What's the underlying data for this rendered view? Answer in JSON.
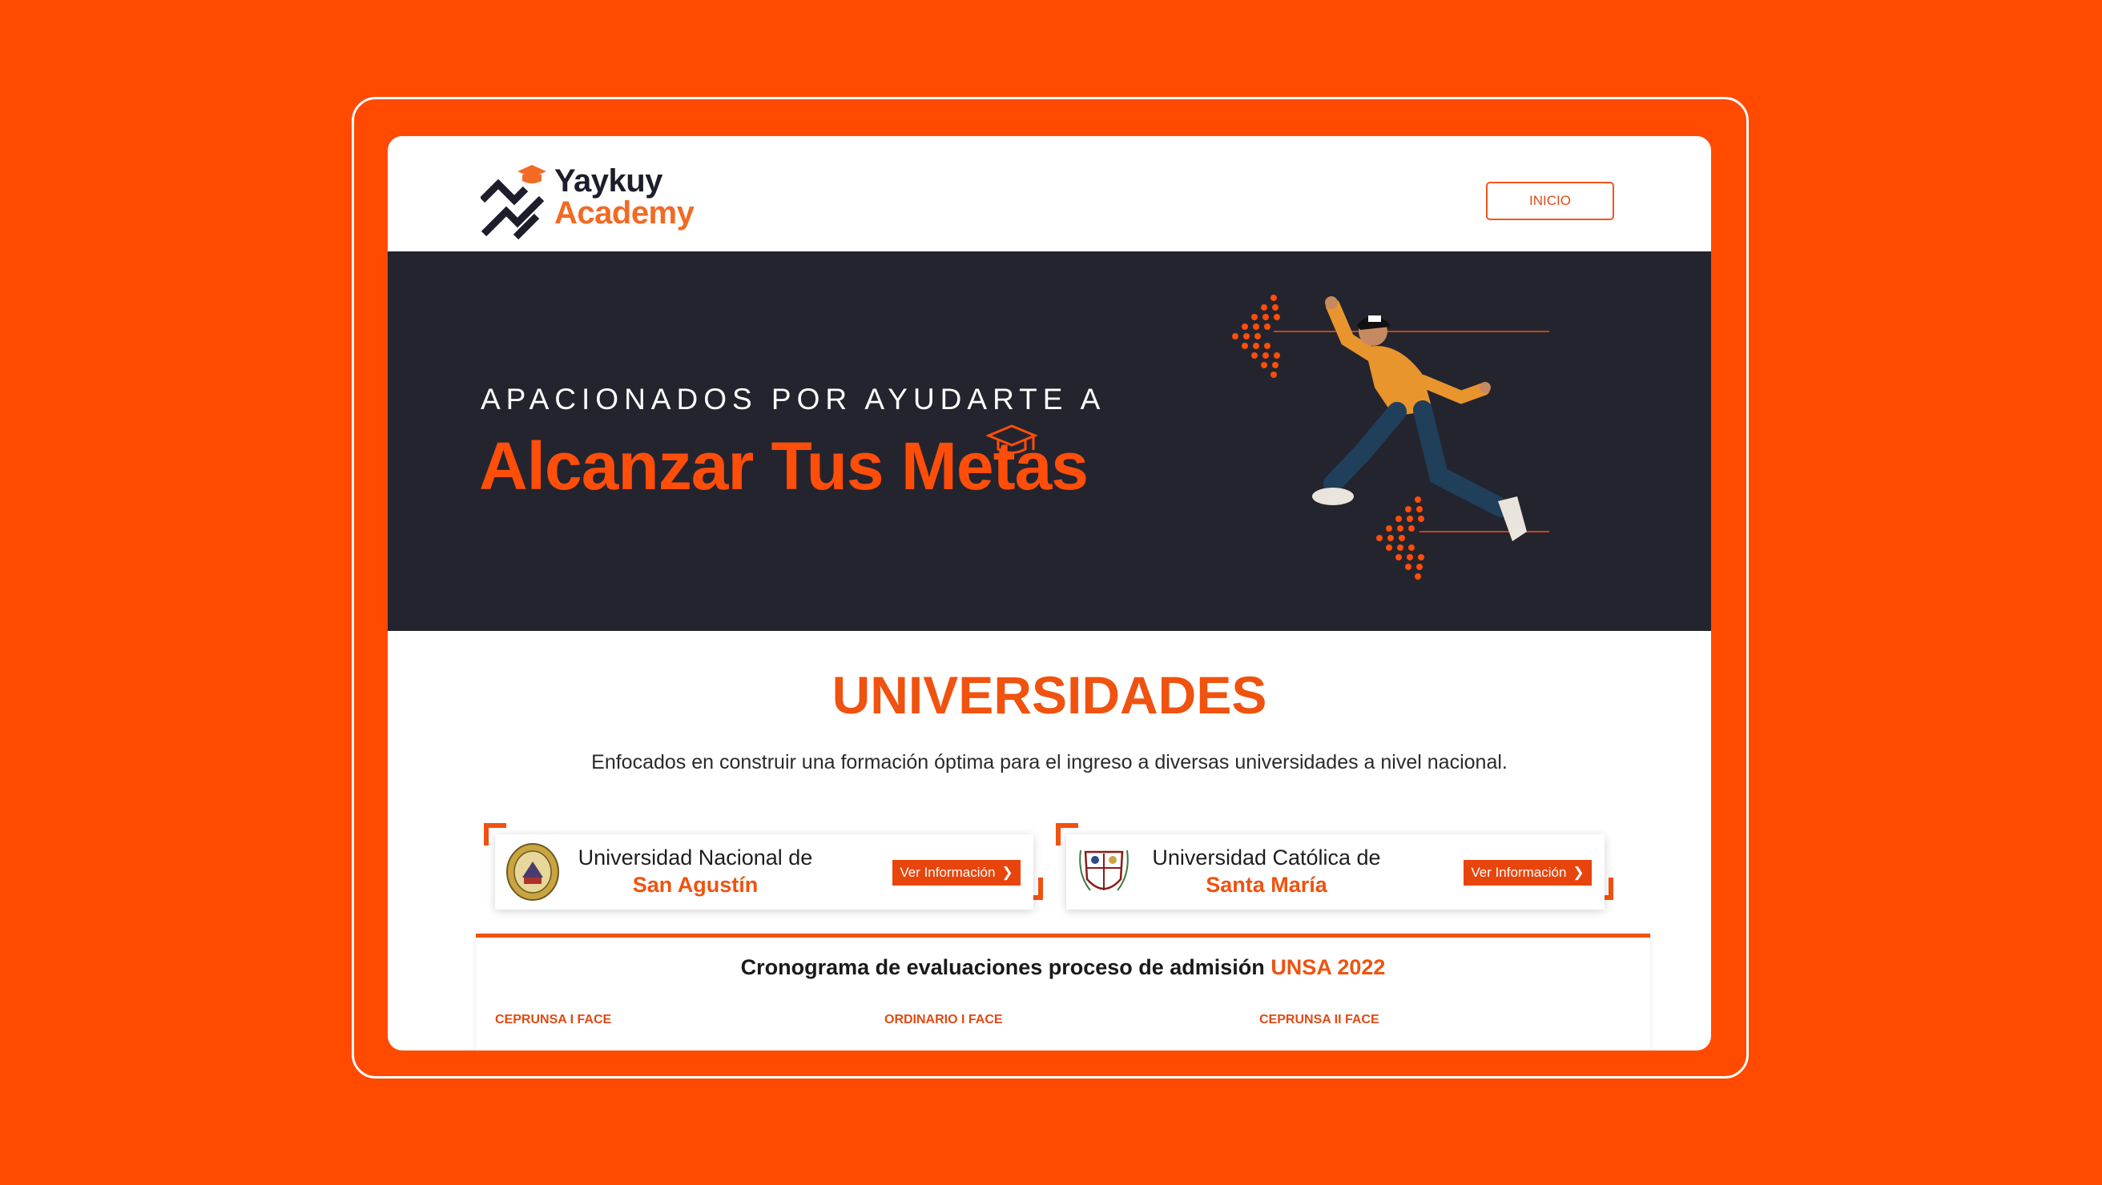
{
  "brand": {
    "name_line1": "Yaykuy",
    "name_line2": "Academy"
  },
  "nav": {
    "home_label": "INICIO"
  },
  "hero": {
    "kicker": "APACIONADOS POR AYUDARTE A",
    "title": "Alcanzar Tus Metas"
  },
  "universities": {
    "title": "UNIVERSIDADES",
    "subtitle": "Enfocados en construir una formación óptima para el ingreso a diversas universidades a nivel nacional.",
    "items": [
      {
        "name_line1": "Universidad Nacional de",
        "name_line2": "San Agustín",
        "button_label": "Ver Información"
      },
      {
        "name_line1": "Universidad Católica de",
        "name_line2": "Santa María",
        "button_label": "Ver Información"
      }
    ]
  },
  "schedule": {
    "title_prefix": "Cronograma de evaluaciones proceso de admisión",
    "title_highlight": "UNSA 2022",
    "columns": [
      "CEPRUNSA I FACE",
      "ORDINARIO I FACE",
      "CEPRUNSA II FACE"
    ]
  },
  "colors": {
    "background": "#FF4A00",
    "accent": "#F0520F",
    "hero_bg": "#24242E"
  }
}
